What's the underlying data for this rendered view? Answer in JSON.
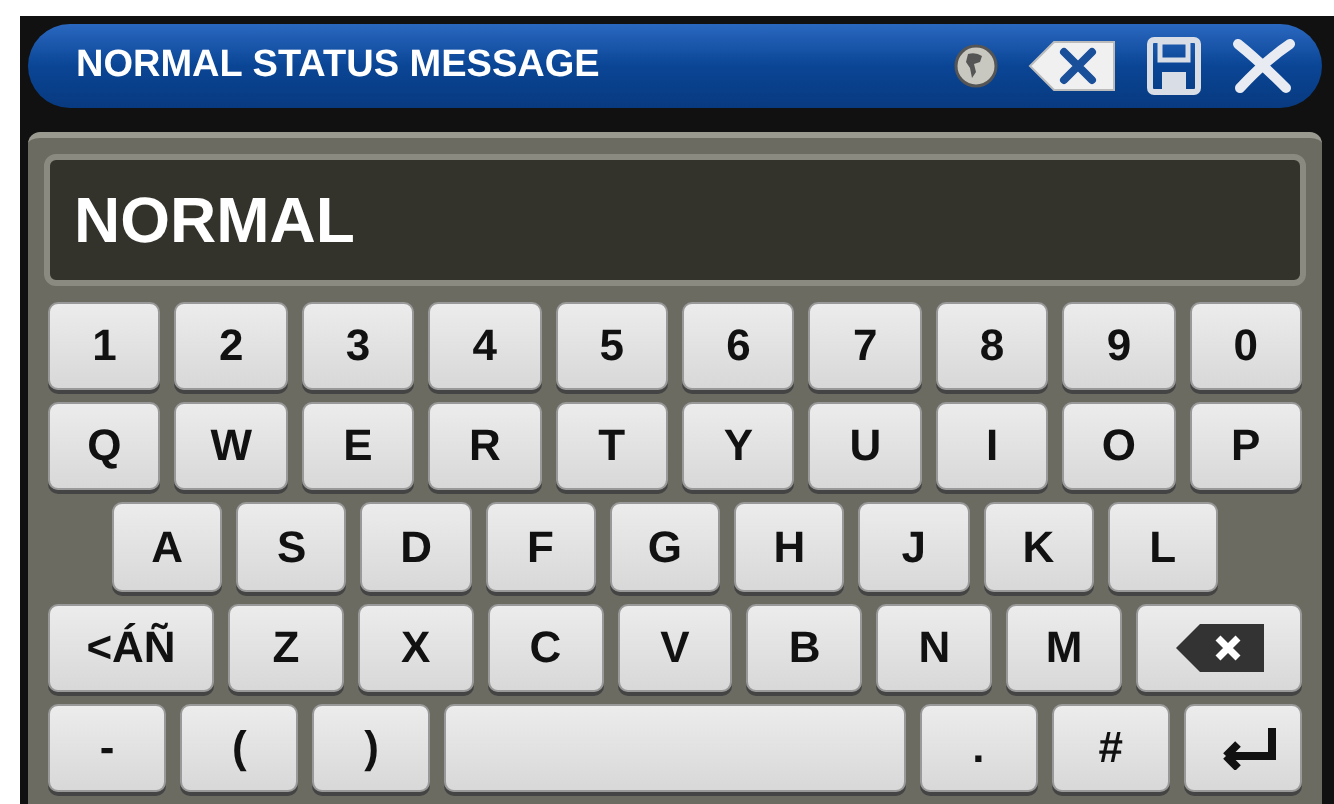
{
  "title_bar": {
    "title": "NORMAL STATUS MESSAGE",
    "buttons": [
      {
        "kind": "globe"
      },
      {
        "kind": "clear"
      },
      {
        "kind": "save"
      },
      {
        "kind": "close"
      }
    ]
  },
  "display": {
    "value": "NORMAL"
  },
  "keyboard": {
    "rows": [
      {
        "indent": false,
        "keys": [
          {
            "kind": "char",
            "label": "1"
          },
          {
            "kind": "char",
            "label": "2"
          },
          {
            "kind": "char",
            "label": "3"
          },
          {
            "kind": "char",
            "label": "4"
          },
          {
            "kind": "char",
            "label": "5"
          },
          {
            "kind": "char",
            "label": "6"
          },
          {
            "kind": "char",
            "label": "7"
          },
          {
            "kind": "char",
            "label": "8"
          },
          {
            "kind": "char",
            "label": "9"
          },
          {
            "kind": "char",
            "label": "0"
          }
        ]
      },
      {
        "indent": false,
        "keys": [
          {
            "kind": "char",
            "label": "Q"
          },
          {
            "kind": "char",
            "label": "W"
          },
          {
            "kind": "char",
            "label": "E"
          },
          {
            "kind": "char",
            "label": "R"
          },
          {
            "kind": "char",
            "label": "T"
          },
          {
            "kind": "char",
            "label": "Y"
          },
          {
            "kind": "char",
            "label": "U"
          },
          {
            "kind": "char",
            "label": "I"
          },
          {
            "kind": "char",
            "label": "O"
          },
          {
            "kind": "char",
            "label": "P"
          }
        ]
      },
      {
        "indent": true,
        "keys": [
          {
            "kind": "char",
            "label": "A"
          },
          {
            "kind": "char",
            "label": "S"
          },
          {
            "kind": "char",
            "label": "D"
          },
          {
            "kind": "char",
            "label": "F"
          },
          {
            "kind": "char",
            "label": "G"
          },
          {
            "kind": "char",
            "label": "H"
          },
          {
            "kind": "char",
            "label": "J"
          },
          {
            "kind": "char",
            "label": "K"
          },
          {
            "kind": "char",
            "label": "L"
          }
        ]
      },
      {
        "indent": false,
        "keys": [
          {
            "kind": "wide",
            "label": "<ÁÑ"
          },
          {
            "kind": "char",
            "label": "Z"
          },
          {
            "kind": "char",
            "label": "X"
          },
          {
            "kind": "char",
            "label": "C"
          },
          {
            "kind": "char",
            "label": "V"
          },
          {
            "kind": "char",
            "label": "B"
          },
          {
            "kind": "char",
            "label": "N"
          },
          {
            "kind": "char",
            "label": "M"
          },
          {
            "kind": "backspace"
          }
        ]
      },
      {
        "indent": false,
        "keys": [
          {
            "kind": "char",
            "label": "-"
          },
          {
            "kind": "char",
            "label": "("
          },
          {
            "kind": "char",
            "label": ")"
          },
          {
            "kind": "space"
          },
          {
            "kind": "char",
            "label": "."
          },
          {
            "kind": "char",
            "label": "#"
          },
          {
            "kind": "enter"
          }
        ]
      }
    ]
  }
}
